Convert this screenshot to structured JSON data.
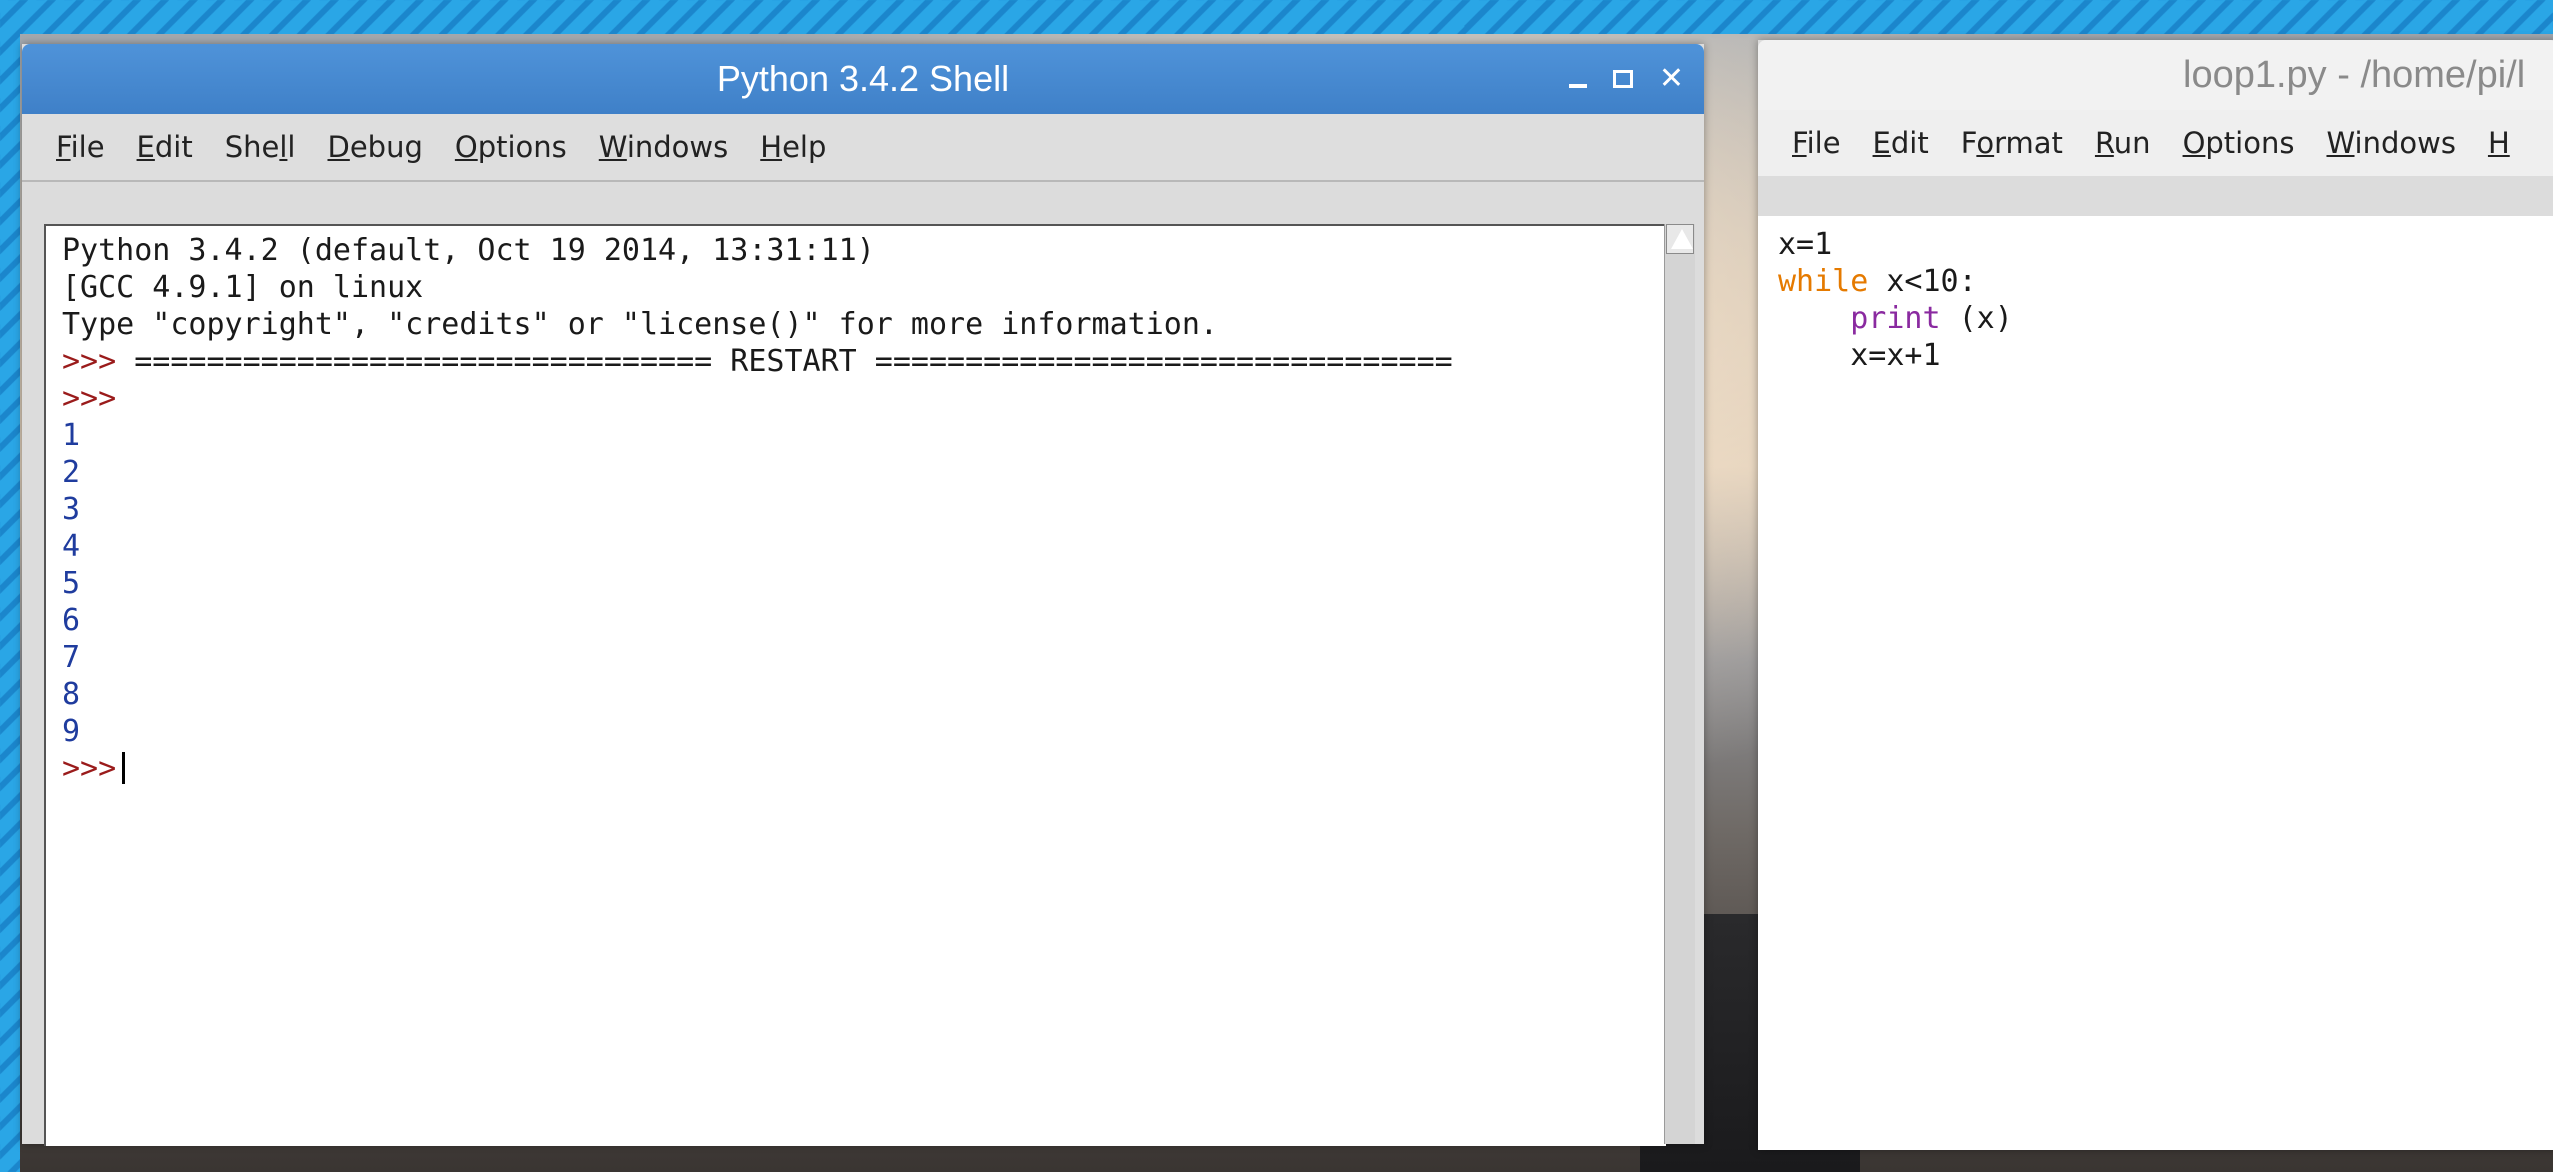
{
  "shell": {
    "title": "Python 3.4.2 Shell",
    "menu": [
      {
        "accel": "F",
        "rest": "ile"
      },
      {
        "accel": "E",
        "rest": "dit"
      },
      {
        "pre": "She",
        "accel": "l",
        "rest": "l"
      },
      {
        "accel": "D",
        "rest": "ebug"
      },
      {
        "accel": "O",
        "rest": "ptions"
      },
      {
        "accel": "W",
        "rest": "indows"
      },
      {
        "accel": "H",
        "rest": "elp"
      }
    ],
    "lines": {
      "banner1": "Python 3.4.2 (default, Oct 19 2014, 13:31:11)",
      "banner2": "[GCC 4.9.1] on linux",
      "banner3": "Type \"copyright\", \"credits\" or \"license()\" for more information.",
      "restart_prompt": ">>> ",
      "restart_text": "================================ RESTART ================================",
      "prompt": ">>>",
      "outputs": [
        "1",
        "2",
        "3",
        "4",
        "5",
        "6",
        "7",
        "8",
        "9"
      ],
      "final_prompt": ">>>"
    }
  },
  "editor": {
    "title": "loop1.py - /home/pi/l",
    "menu": [
      {
        "accel": "F",
        "rest": "ile"
      },
      {
        "accel": "E",
        "rest": "dit"
      },
      {
        "pre": "F",
        "accel": "o",
        "rest": "rmat"
      },
      {
        "accel": "R",
        "rest": "un"
      },
      {
        "accel": "O",
        "rest": "ptions"
      },
      {
        "accel": "W",
        "rest": "indows"
      },
      {
        "accel": "H",
        "rest": ""
      }
    ],
    "code": {
      "line1": "x=1",
      "line2_keyword": "while",
      "line2_rest": " x<10:",
      "line3_indent": "    ",
      "line3_builtin": "print",
      "line3_rest": " (x)",
      "line4": "    x=x+1"
    }
  }
}
